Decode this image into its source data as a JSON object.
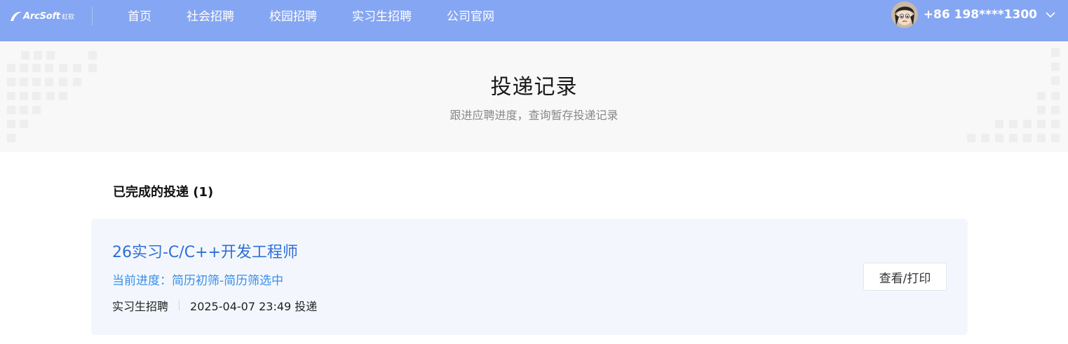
{
  "header": {
    "logo_text": "ArcSoft",
    "logo_cn": "虹软",
    "nav": [
      "首页",
      "社会招聘",
      "校园招聘",
      "实习生招聘",
      "公司官网"
    ],
    "user_phone": "+86 198****1300"
  },
  "hero": {
    "title": "投递记录",
    "subtitle": "跟进应聘进度，查询暂存投递记录"
  },
  "section": {
    "title": "已完成的投递 (1)"
  },
  "applications": [
    {
      "job_title": "26实习-C/C++开发工程师",
      "progress": "当前进度：简历初筛-简历筛选中",
      "category": "实习生招聘",
      "submitted": "2025-04-07 23:49 投递",
      "action_label": "查看/打印"
    }
  ],
  "colors": {
    "header_bg": "#85a6f2",
    "link_blue": "#2f6fd6",
    "progress_blue": "#3a8ee6",
    "card_bg": "#f3f7fd"
  }
}
